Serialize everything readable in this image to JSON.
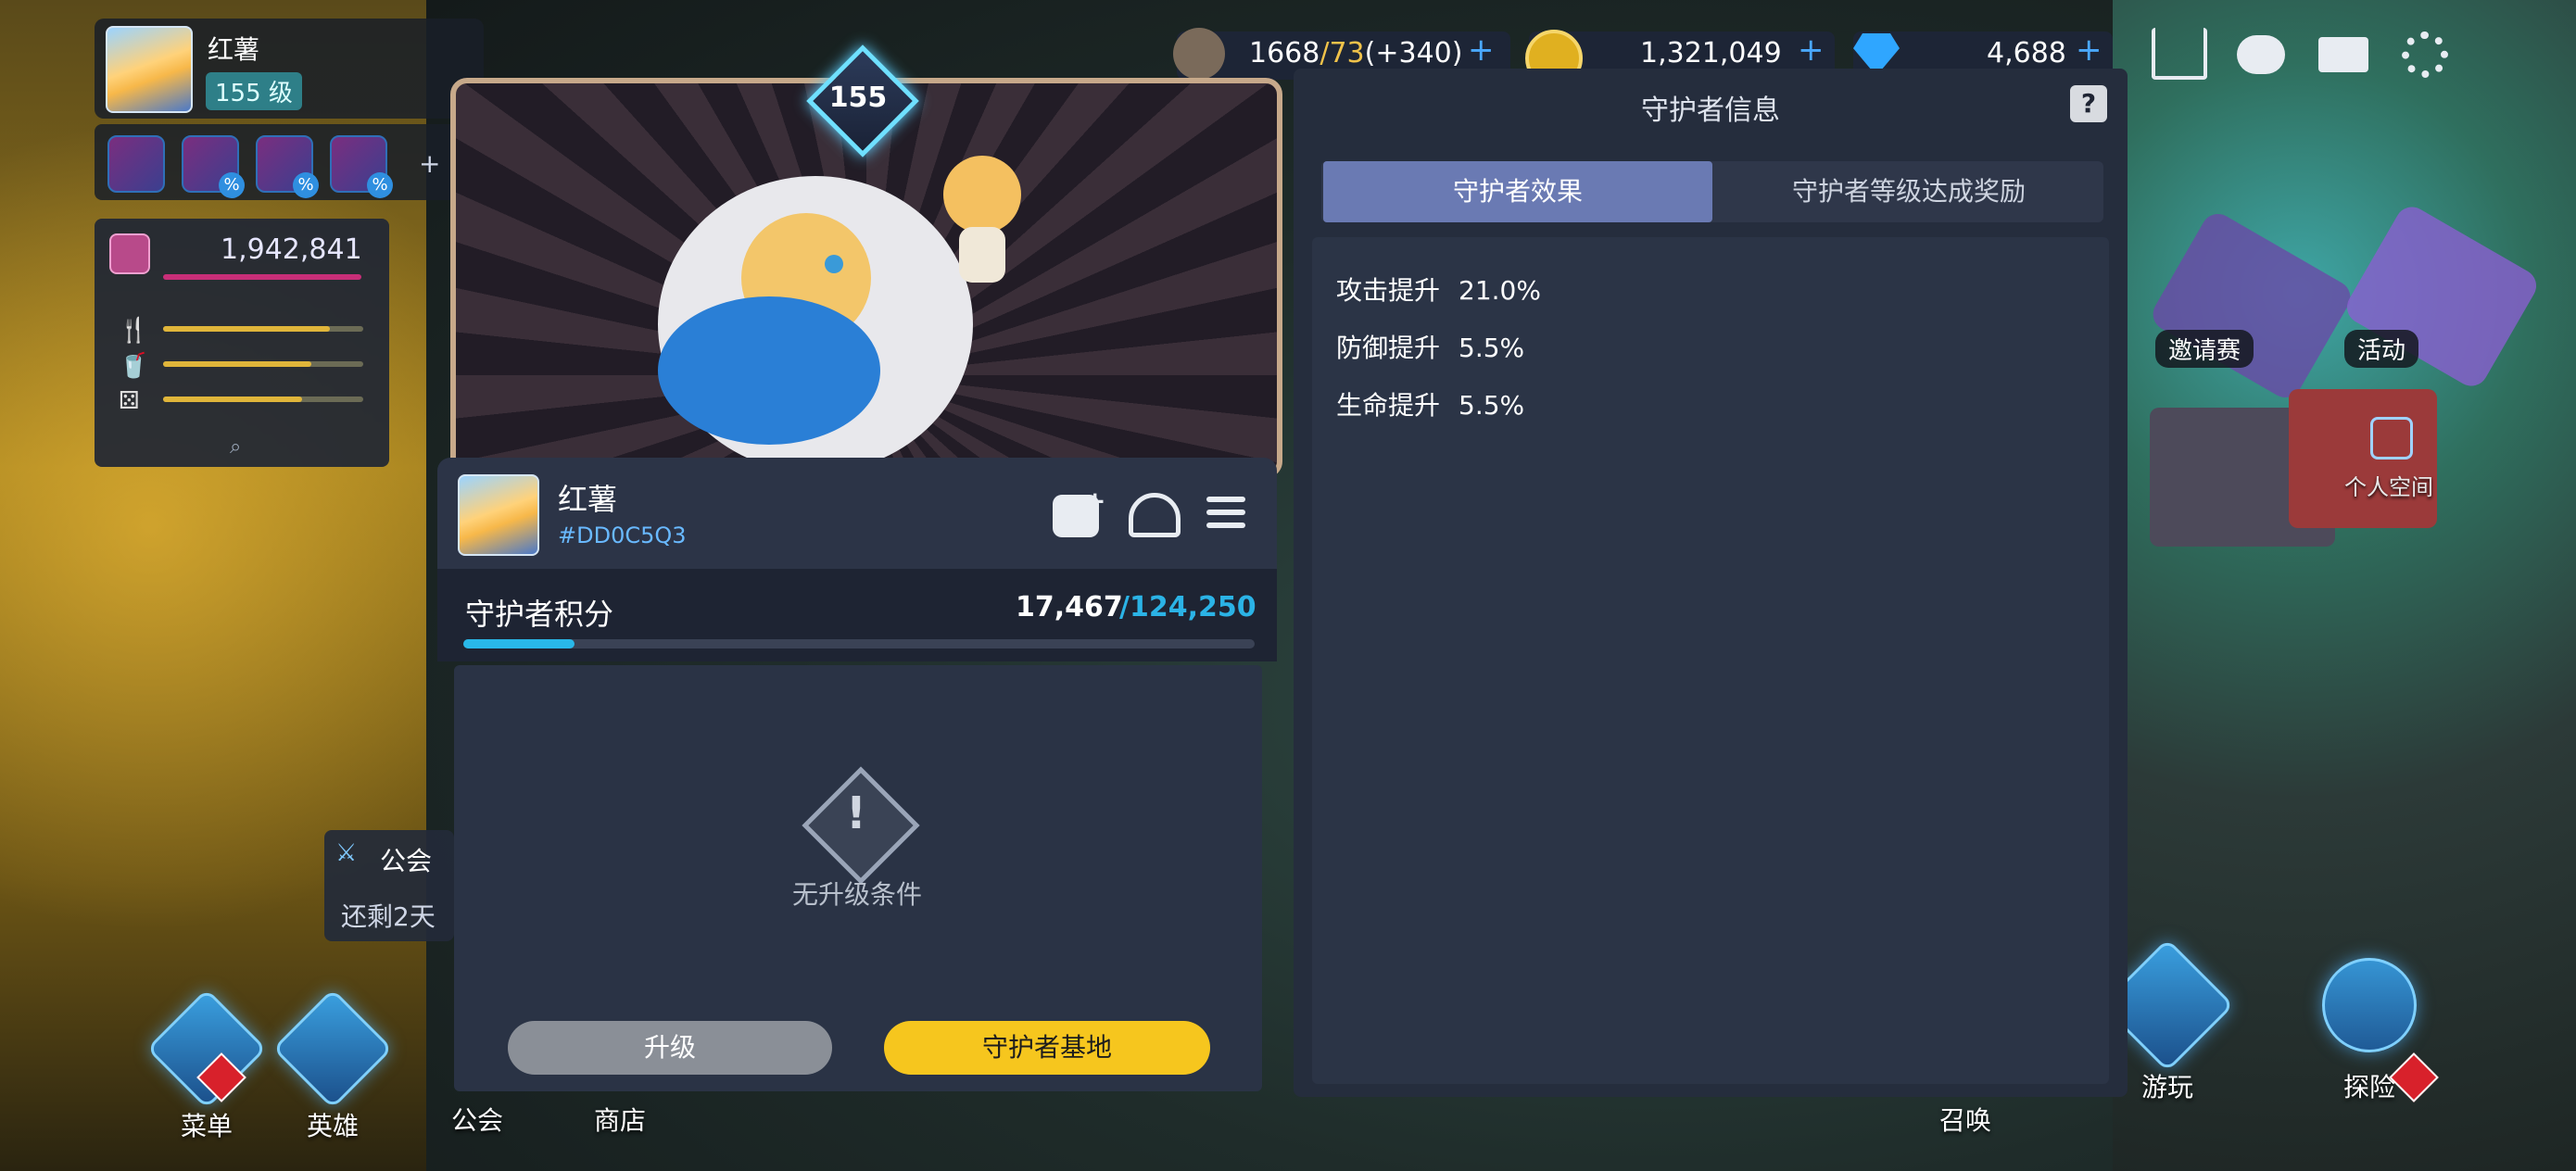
{
  "player": {
    "name": "红薯",
    "level": "155 级",
    "gem_total": "1,942,841"
  },
  "resources": {
    "stamina": "1668",
    "stamina_max": "/73",
    "stamina_bonus": "(+340)",
    "gold": "1,321,049",
    "diamond": "4,688",
    "plus": "+"
  },
  "guild_banner": {
    "title": "公会",
    "subtitle": "还剩2天"
  },
  "bottom_nav": [
    {
      "label": "菜单"
    },
    {
      "label": "英雄"
    },
    {
      "label": "公会"
    },
    {
      "label": "商店"
    }
  ],
  "bottom_nav_right": [
    {
      "label": "召唤"
    },
    {
      "label": "游玩"
    },
    {
      "label": "探险"
    }
  ],
  "world_labels": {
    "invite": "邀请赛",
    "event": "活动",
    "space": "个人空间"
  },
  "guardian": {
    "level": "155",
    "name": "红薯",
    "id": "#DD0C5Q3",
    "score_label": "守护者积分",
    "score_current": "17,467",
    "score_max": "/124,250",
    "score_progress": 0.1406,
    "no_condition": "无升级条件",
    "upgrade_label": "升级",
    "base_label": "守护者基地"
  },
  "info_panel": {
    "title": "守护者信息",
    "help": "?",
    "tabs": [
      "守护者效果",
      "守护者等级达成奖励"
    ],
    "effects": [
      {
        "label": "攻击提升",
        "value": "21.0%"
      },
      {
        "label": "防御提升",
        "value": "5.5%"
      },
      {
        "label": "生命提升",
        "value": "5.5%"
      }
    ]
  },
  "colors": {
    "accent_blue": "#29b8e8",
    "tab_active": "#6a7ab3",
    "primary_button": "#f6c61e",
    "disabled_button": "#8a8f97",
    "id_text": "#69b9ff"
  }
}
